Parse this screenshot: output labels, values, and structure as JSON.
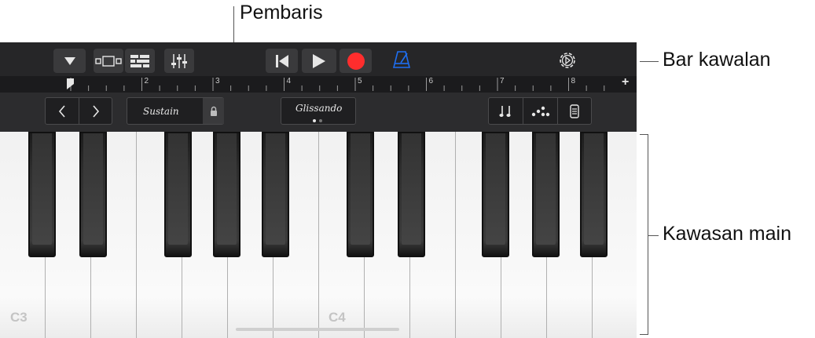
{
  "callouts": {
    "ruler": "Pembaris",
    "control_bar": "Bar kawalan",
    "play_area": "Kawasan main"
  },
  "ruler": {
    "bars": [
      "2",
      "3",
      "4",
      "5",
      "6",
      "7",
      "8"
    ],
    "add_label": "+"
  },
  "smart_controls": {
    "sustain_label": "Sustain",
    "glissando_label": "Glissando"
  },
  "keyboard": {
    "labels": [
      "C3",
      "C4"
    ]
  },
  "colors": {
    "record": "#ff2d2d",
    "metronome": "#1e6ff2",
    "bar_bg": "#262628"
  }
}
